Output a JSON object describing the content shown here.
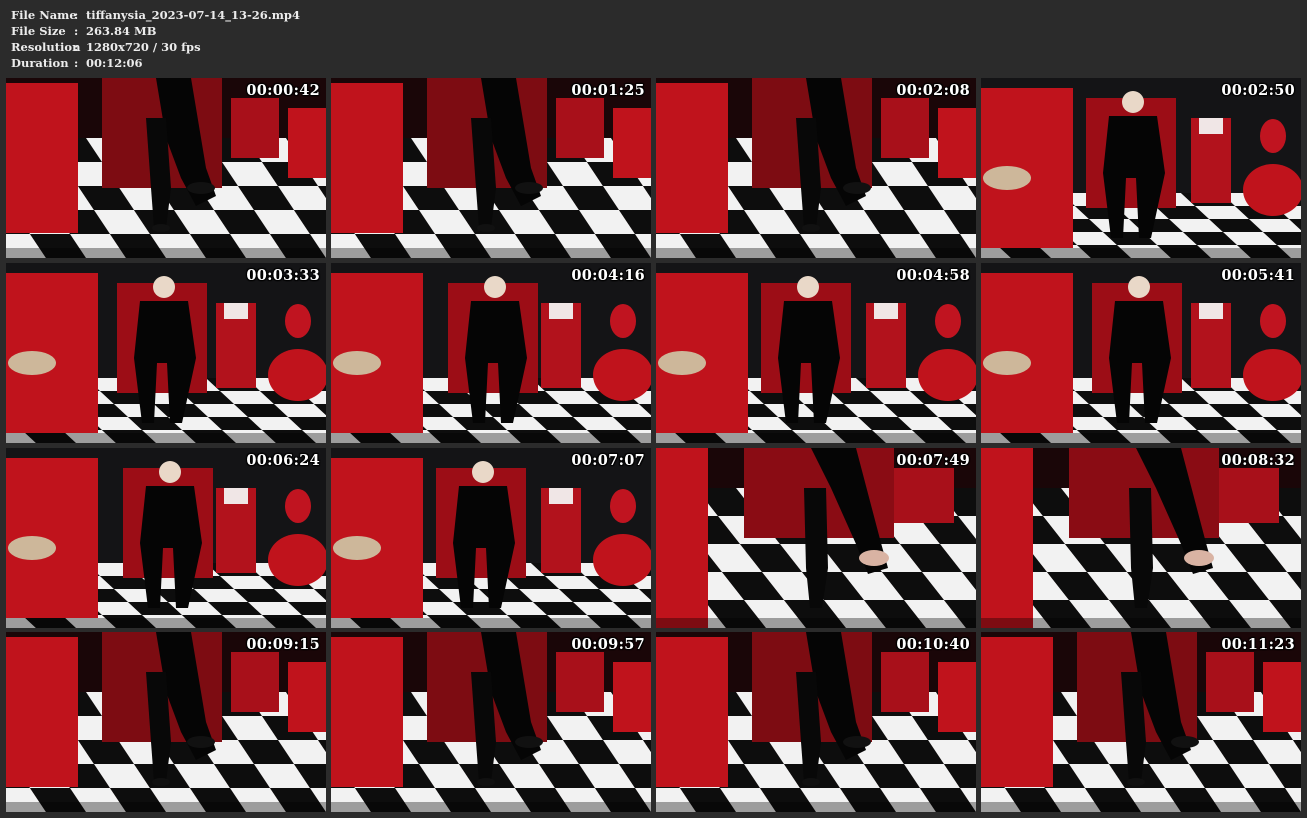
{
  "file_info": {
    "file_name_label": "File Name",
    "file_name": "tiffanysia_2023-07-14_13-26.mp4",
    "file_size_label": "File Size",
    "file_size": "263.84 MB",
    "resolution_label": "Resolution",
    "resolution": "1280x720 / 30 fps",
    "duration_label": "Duration",
    "duration": "00:12:06",
    "separator": ":"
  },
  "thumbnails": [
    {
      "timestamp": "00:00:42",
      "scene": "legs"
    },
    {
      "timestamp": "00:01:25",
      "scene": "legs"
    },
    {
      "timestamp": "00:02:08",
      "scene": "legs"
    },
    {
      "timestamp": "00:02:50",
      "scene": "seated"
    },
    {
      "timestamp": "00:03:33",
      "scene": "seated"
    },
    {
      "timestamp": "00:04:16",
      "scene": "seated"
    },
    {
      "timestamp": "00:04:58",
      "scene": "seated"
    },
    {
      "timestamp": "00:05:41",
      "scene": "seated"
    },
    {
      "timestamp": "00:06:24",
      "scene": "seated"
    },
    {
      "timestamp": "00:07:07",
      "scene": "seated"
    },
    {
      "timestamp": "00:07:49",
      "scene": "closeup"
    },
    {
      "timestamp": "00:08:32",
      "scene": "closeup"
    },
    {
      "timestamp": "00:09:15",
      "scene": "legs"
    },
    {
      "timestamp": "00:09:57",
      "scene": "legs"
    },
    {
      "timestamp": "00:10:40",
      "scene": "legs"
    },
    {
      "timestamp": "00:11:23",
      "scene": "legs"
    }
  ],
  "colors": {
    "background": "#2b2b2b",
    "text": "#ececec",
    "accent_red": "#c0131c",
    "floor_black": "#0d0d0d",
    "floor_white": "#f2f2f2"
  }
}
